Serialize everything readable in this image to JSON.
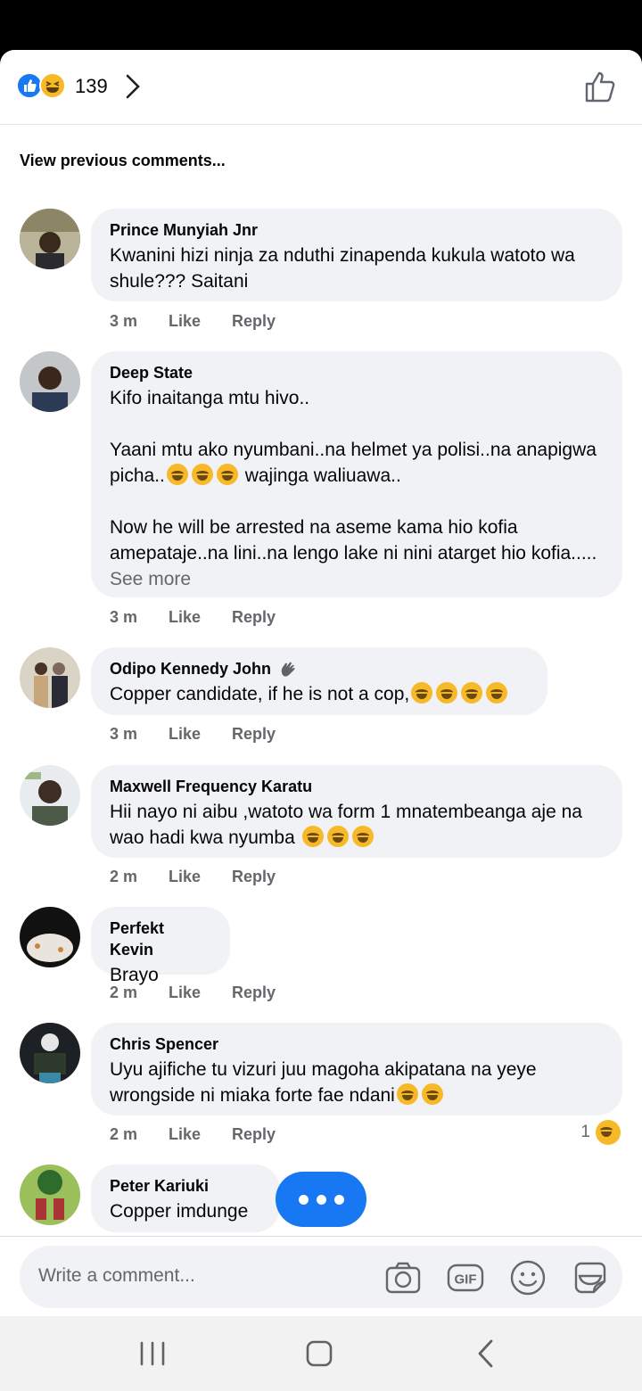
{
  "reactions": {
    "count": "139",
    "icons": [
      "like-reaction-icon",
      "haha-reaction-icon"
    ]
  },
  "view_previous": "View previous comments...",
  "comments": [
    {
      "name": "Prince Munyiah Jnr",
      "text": "Kwanini hizi ninja za nduthi zinapenda kukula watoto wa shule??? Saitani",
      "time": "3 m",
      "like": "Like",
      "reply": "Reply"
    },
    {
      "name": "Deep State",
      "text_1": "Kifo inaitanga mtu hivo..",
      "text_2": "Yaani mtu ako nyumbani..na helmet ya polisi..na anapigwa picha..",
      "text_2_after": " wajinga waliuawa..",
      "text_3": "Now he will be arrested na aseme kama hio kofia amepataje..na lini..na lengo lake ni nini atarget hio kofia.....",
      "see_more": " See more",
      "time": "3 m",
      "like": "Like",
      "reply": "Reply"
    },
    {
      "name": "Odipo Kennedy John",
      "text": "Copper candidate, if he is not a cop,",
      "time": "3 m",
      "like": "Like",
      "reply": "Reply"
    },
    {
      "name": "Maxwell Frequency Karatu",
      "text": "Hii nayo ni aibu ,watoto wa form 1 mnatembeanga aje na wao hadi kwa nyumba ",
      "time": "2 m",
      "like": "Like",
      "reply": "Reply"
    },
    {
      "name": "Perfekt Kevin",
      "text": "Brayo",
      "time": "2 m",
      "like": "Like",
      "reply": "Reply"
    },
    {
      "name": "Chris Spencer",
      "text": "Uyu ajifiche tu vizuri juu magoha akipatana na yeye wrongside ni miaka forte fae ndani",
      "time": "2 m",
      "like": "Like",
      "reply": "Reply",
      "reaction_count": "1"
    },
    {
      "name": "Peter Kariuki",
      "text": "Copper imdunge"
    }
  ],
  "composer": {
    "placeholder": "Write a comment..."
  },
  "colors": {
    "accent": "#1877f2",
    "bubble": "#f0f2f5",
    "meta": "#65676b"
  }
}
